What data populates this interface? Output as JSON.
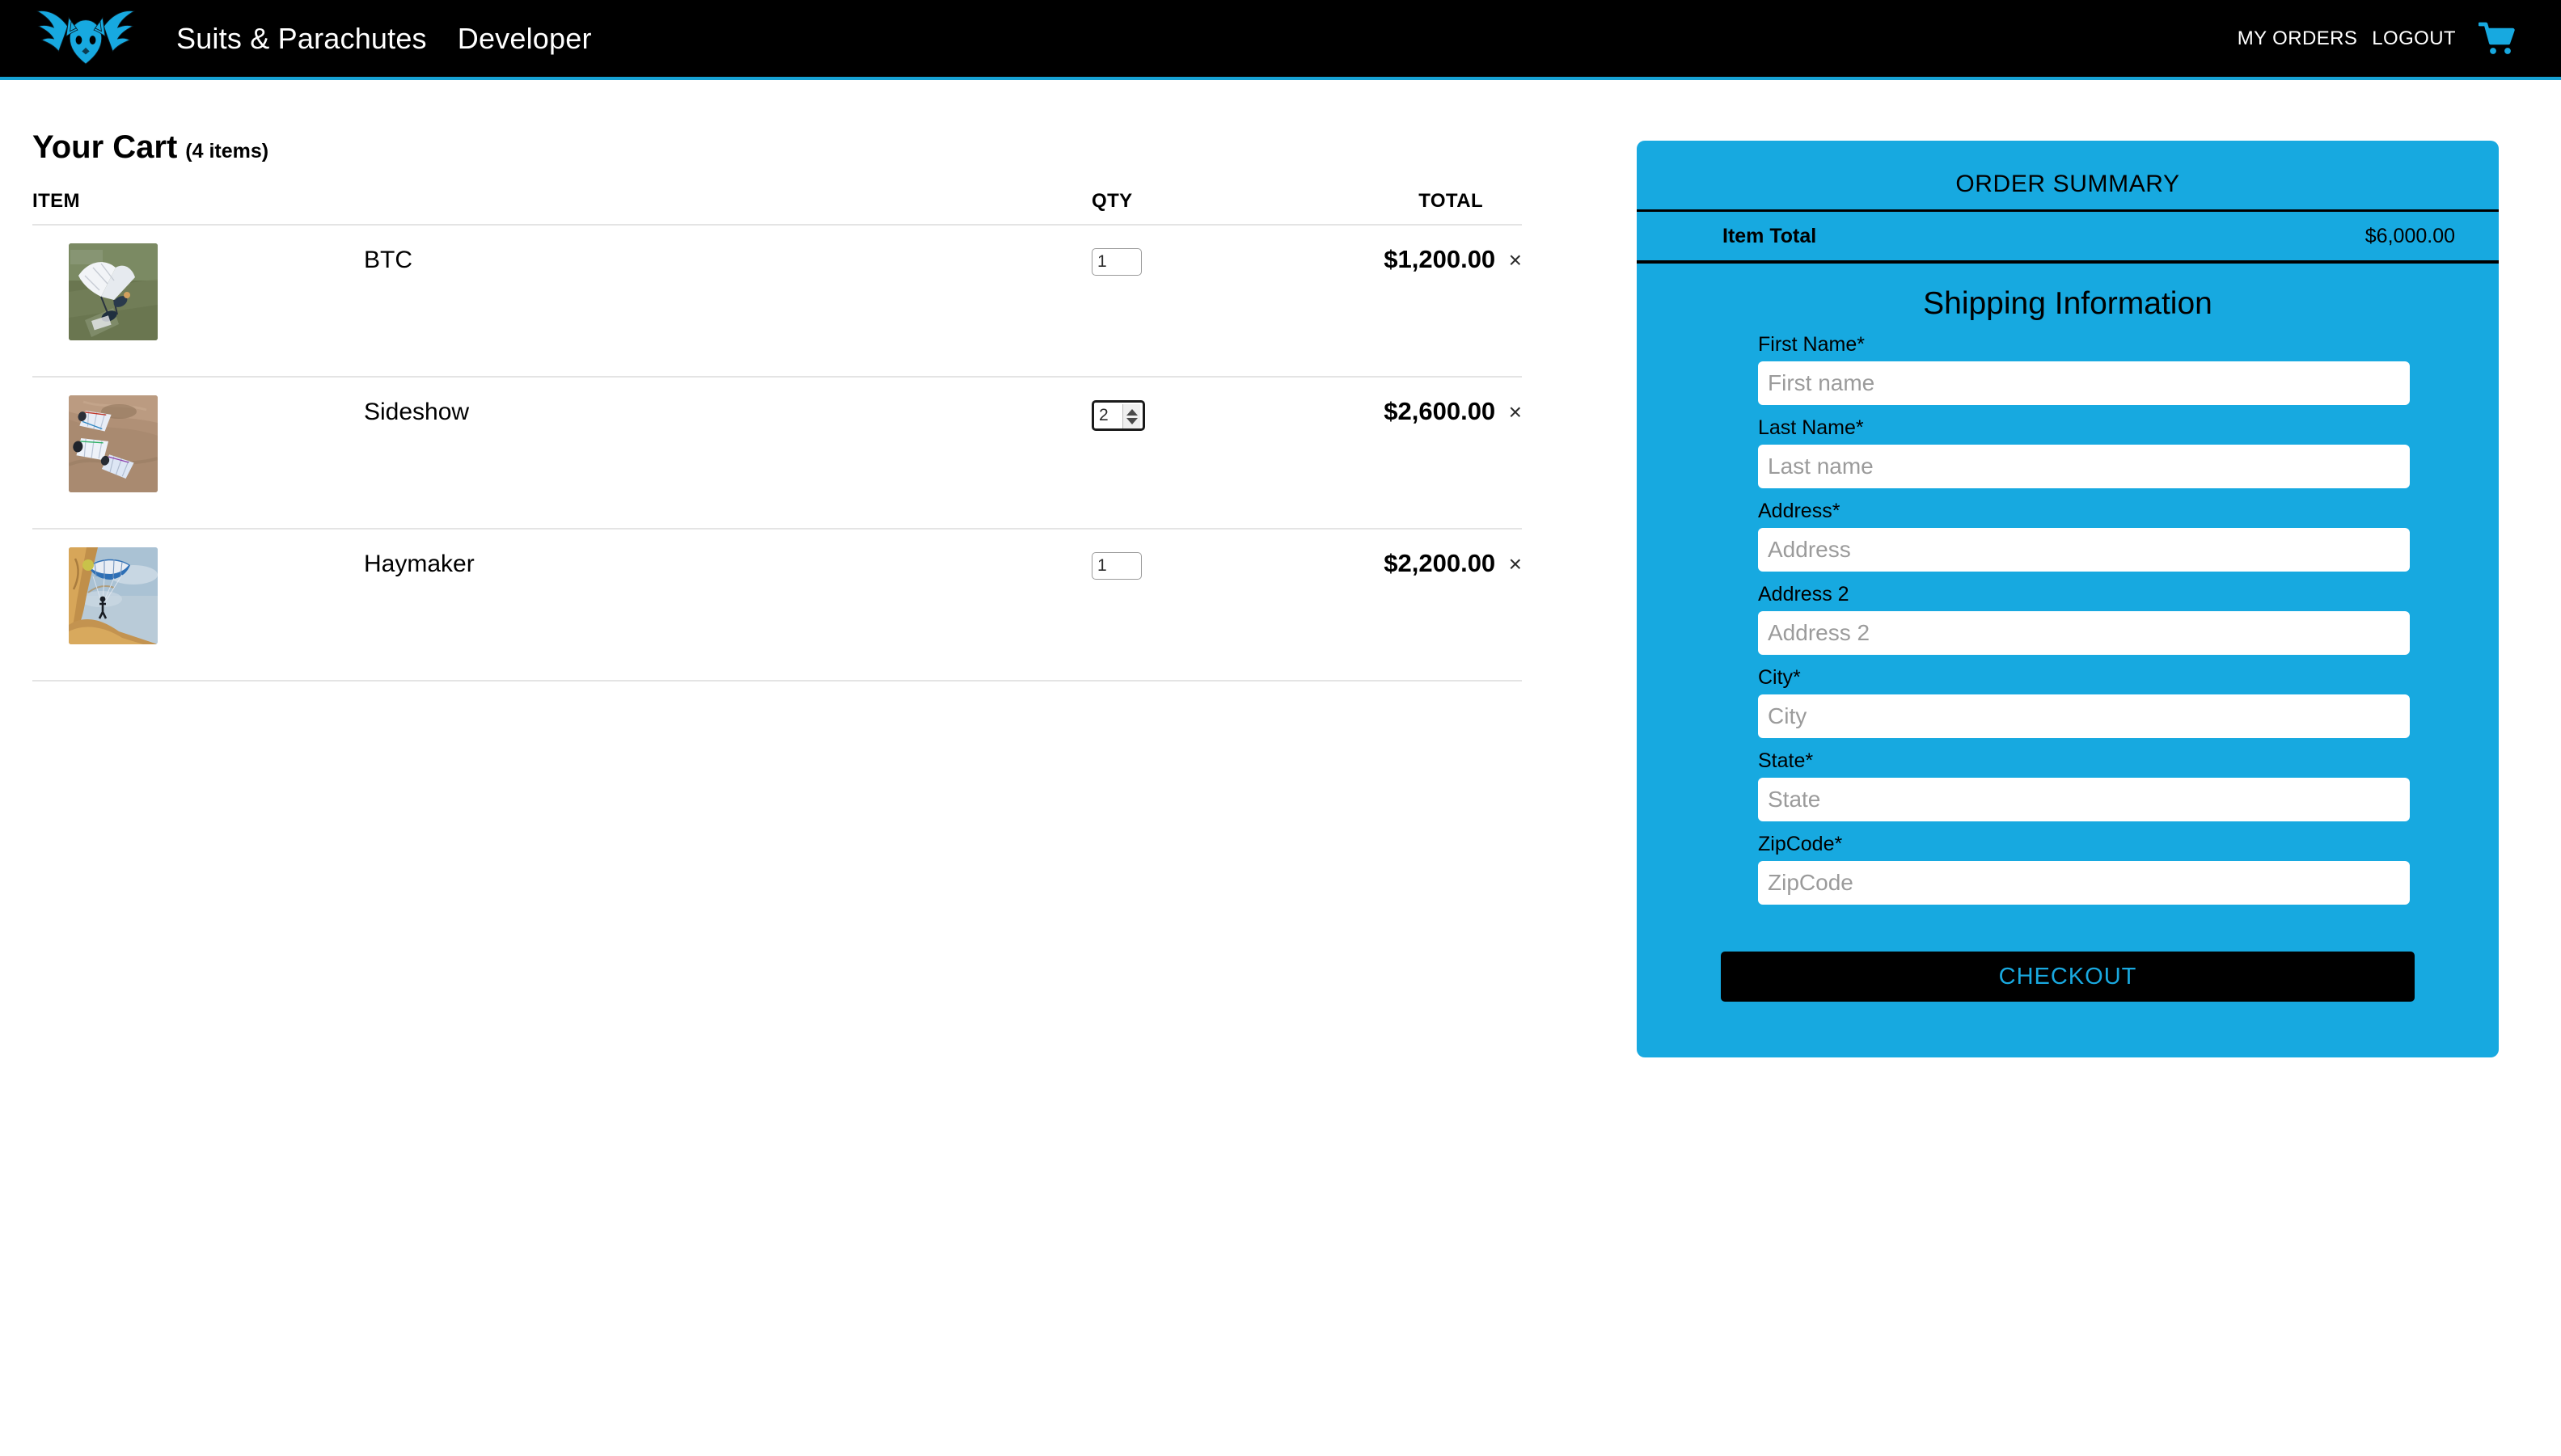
{
  "header": {
    "logo_icon": "winged-fox-logo",
    "nav_links": [
      {
        "label": "Suits & Parachutes"
      },
      {
        "label": "Developer"
      }
    ],
    "right_links": [
      {
        "label": "MY ORDERS"
      },
      {
        "label": "LOGOUT"
      }
    ],
    "cart_icon": "shopping-cart-icon",
    "accent_color": "#17a9e0",
    "background_color": "#000000"
  },
  "cart": {
    "title": "Your Cart",
    "count_label": "(4 items)",
    "columns": {
      "item": "ITEM",
      "qty": "QTY",
      "total": "TOTAL"
    },
    "rows": [
      {
        "name": "BTC",
        "qty": "1",
        "total": "$1,200.00",
        "remove_label": "×",
        "thumb": "skydiver-white-canopy-aerial",
        "focused": false
      },
      {
        "name": "Sideshow",
        "qty": "2",
        "total": "$2,600.00",
        "remove_label": "×",
        "thumb": "three-wingsuit-flyers-desert",
        "focused": true
      },
      {
        "name": "Haymaker",
        "qty": "1",
        "total": "$2,200.00",
        "remove_label": "×",
        "thumb": "paraglider-golden-cliff",
        "focused": false
      }
    ]
  },
  "summary": {
    "title": "ORDER SUMMARY",
    "item_total_label": "Item Total",
    "item_total_value": "$6,000.00",
    "shipping_title": "Shipping Information",
    "fields": [
      {
        "label": "First Name*",
        "placeholder": "First name",
        "value": ""
      },
      {
        "label": "Last Name*",
        "placeholder": "Last name",
        "value": ""
      },
      {
        "label": "Address*",
        "placeholder": "Address",
        "value": ""
      },
      {
        "label": "Address 2",
        "placeholder": "Address 2",
        "value": ""
      },
      {
        "label": "City*",
        "placeholder": "City",
        "value": ""
      },
      {
        "label": "State*",
        "placeholder": "State",
        "value": ""
      },
      {
        "label": "ZipCode*",
        "placeholder": "ZipCode",
        "value": ""
      }
    ],
    "checkout_label": "CHECKOUT",
    "panel_color": "#17a9e0",
    "checkout_bg": "#000000",
    "checkout_text_color": "#19a9e0"
  }
}
